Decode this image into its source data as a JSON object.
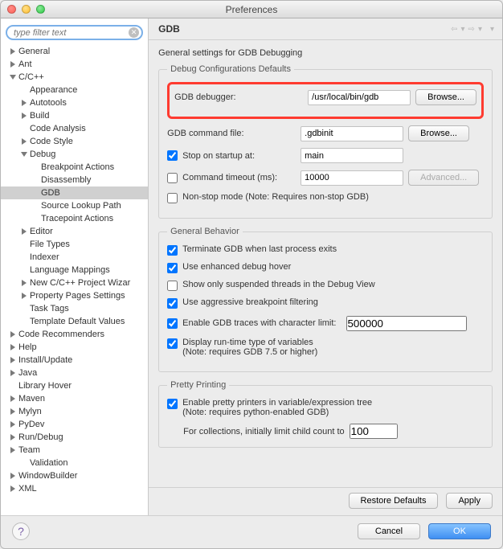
{
  "window": {
    "title": "Preferences"
  },
  "sidebar": {
    "filter_placeholder": "type filter text",
    "items": [
      {
        "label": "General",
        "level": 0,
        "state": "closed"
      },
      {
        "label": "Ant",
        "level": 0,
        "state": "closed"
      },
      {
        "label": "C/C++",
        "level": 0,
        "state": "open"
      },
      {
        "label": "Appearance",
        "level": 1,
        "state": "leaf"
      },
      {
        "label": "Autotools",
        "level": 1,
        "state": "closed"
      },
      {
        "label": "Build",
        "level": 1,
        "state": "closed"
      },
      {
        "label": "Code Analysis",
        "level": 1,
        "state": "leaf"
      },
      {
        "label": "Code Style",
        "level": 1,
        "state": "closed"
      },
      {
        "label": "Debug",
        "level": 1,
        "state": "open"
      },
      {
        "label": "Breakpoint Actions",
        "level": 2,
        "state": "leaf"
      },
      {
        "label": "Disassembly",
        "level": 2,
        "state": "leaf"
      },
      {
        "label": "GDB",
        "level": 2,
        "state": "leaf",
        "selected": true
      },
      {
        "label": "Source Lookup Path",
        "level": 2,
        "state": "leaf"
      },
      {
        "label": "Tracepoint Actions",
        "level": 2,
        "state": "leaf"
      },
      {
        "label": "Editor",
        "level": 1,
        "state": "closed"
      },
      {
        "label": "File Types",
        "level": 1,
        "state": "leaf"
      },
      {
        "label": "Indexer",
        "level": 1,
        "state": "leaf"
      },
      {
        "label": "Language Mappings",
        "level": 1,
        "state": "leaf"
      },
      {
        "label": "New C/C++ Project Wizar",
        "level": 1,
        "state": "closed"
      },
      {
        "label": "Property Pages Settings",
        "level": 1,
        "state": "closed"
      },
      {
        "label": "Task Tags",
        "level": 1,
        "state": "leaf"
      },
      {
        "label": "Template Default Values",
        "level": 1,
        "state": "leaf"
      },
      {
        "label": "Code Recommenders",
        "level": 0,
        "state": "closed"
      },
      {
        "label": "Help",
        "level": 0,
        "state": "closed"
      },
      {
        "label": "Install/Update",
        "level": 0,
        "state": "closed"
      },
      {
        "label": "Java",
        "level": 0,
        "state": "closed"
      },
      {
        "label": "Library Hover",
        "level": 0,
        "state": "leaf"
      },
      {
        "label": "Maven",
        "level": 0,
        "state": "closed"
      },
      {
        "label": "Mylyn",
        "level": 0,
        "state": "closed"
      },
      {
        "label": "PyDev",
        "level": 0,
        "state": "closed"
      },
      {
        "label": "Run/Debug",
        "level": 0,
        "state": "closed"
      },
      {
        "label": "Team",
        "level": 0,
        "state": "closed"
      },
      {
        "label": "Validation",
        "level": 1,
        "state": "leaf"
      },
      {
        "label": "WindowBuilder",
        "level": 0,
        "state": "closed"
      },
      {
        "label": "XML",
        "level": 0,
        "state": "closed"
      }
    ]
  },
  "page": {
    "heading": "GDB",
    "subtitle": "General settings for GDB Debugging",
    "groups": {
      "defaults": {
        "legend": "Debug Configurations Defaults",
        "debugger_label": "GDB debugger:",
        "debugger_value": "/usr/local/bin/gdb",
        "browse1": "Browse...",
        "cmdfile_label": "GDB command file:",
        "cmdfile_value": ".gdbinit",
        "browse2": "Browse...",
        "stop_label": "Stop on startup at:",
        "stop_checked": true,
        "stop_value": "main",
        "timeout_label": "Command timeout (ms):",
        "timeout_checked": false,
        "timeout_value": "10000",
        "advanced": "Advanced...",
        "nonstop_label": "Non-stop mode (Note: Requires non-stop GDB)",
        "nonstop_checked": false
      },
      "behavior": {
        "legend": "General Behavior",
        "terminate": {
          "label": "Terminate GDB when last process exits",
          "checked": true
        },
        "hover": {
          "label": "Use enhanced debug hover",
          "checked": true
        },
        "suspended": {
          "label": "Show only suspended threads in the Debug View",
          "checked": false
        },
        "aggressive": {
          "label": "Use aggressive breakpoint filtering",
          "checked": true
        },
        "traces": {
          "label": "Enable GDB traces with character limit:",
          "checked": true,
          "value": "500000"
        },
        "runtime": {
          "label": "Display run-time type of variables\n(Note: requires GDB 7.5 or higher)",
          "checked": true
        }
      },
      "pretty": {
        "legend": "Pretty Printing",
        "enable": {
          "label": "Enable pretty printers in variable/expression tree\n(Note: requires python-enabled GDB)",
          "checked": true
        },
        "child_label": "For collections, initially limit child count to",
        "child_value": "100"
      }
    },
    "footer": {
      "restore": "Restore Defaults",
      "apply": "Apply"
    }
  },
  "dialog": {
    "cancel": "Cancel",
    "ok": "OK"
  }
}
